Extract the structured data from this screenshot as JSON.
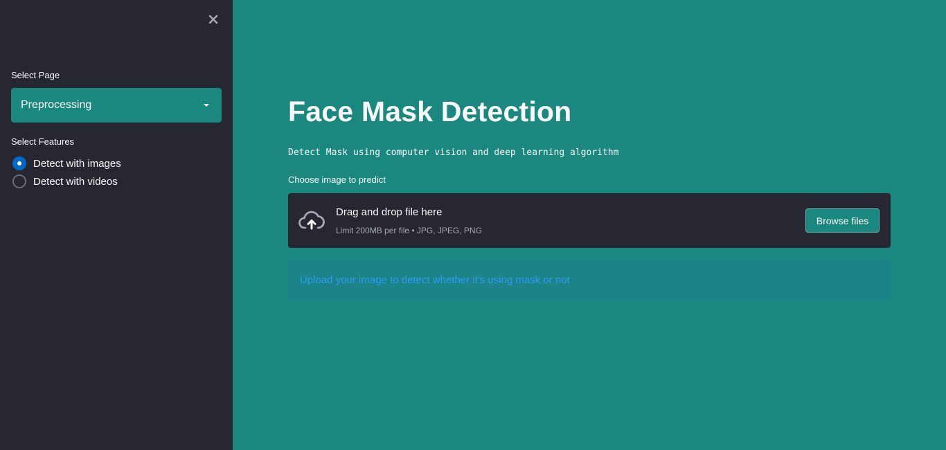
{
  "sidebar": {
    "close_icon": "close-icon",
    "select_page": {
      "label": "Select Page",
      "value": "Preprocessing"
    },
    "select_features": {
      "label": "Select Features",
      "options": [
        {
          "label": "Detect with images",
          "selected": true
        },
        {
          "label": "Detect with videos",
          "selected": false
        }
      ]
    }
  },
  "main": {
    "title": "Face Mask Detection",
    "subtitle": "Detect Mask using computer vision and deep learning algorithm",
    "uploader": {
      "label": "Choose image to predict",
      "drag_text": "Drag and drop file here",
      "limit_text": "Limit 200MB per file • JPG, JPEG, PNG",
      "browse_label": "Browse files",
      "icon": "cloud-upload-icon"
    },
    "info": {
      "text": "Upload your image to detect whether it's using mask or not"
    }
  },
  "colors": {
    "main_background": "#1b887f",
    "sidebar_background": "#262730",
    "accent": "#0068c9",
    "info_text": "#2e9bf5"
  }
}
